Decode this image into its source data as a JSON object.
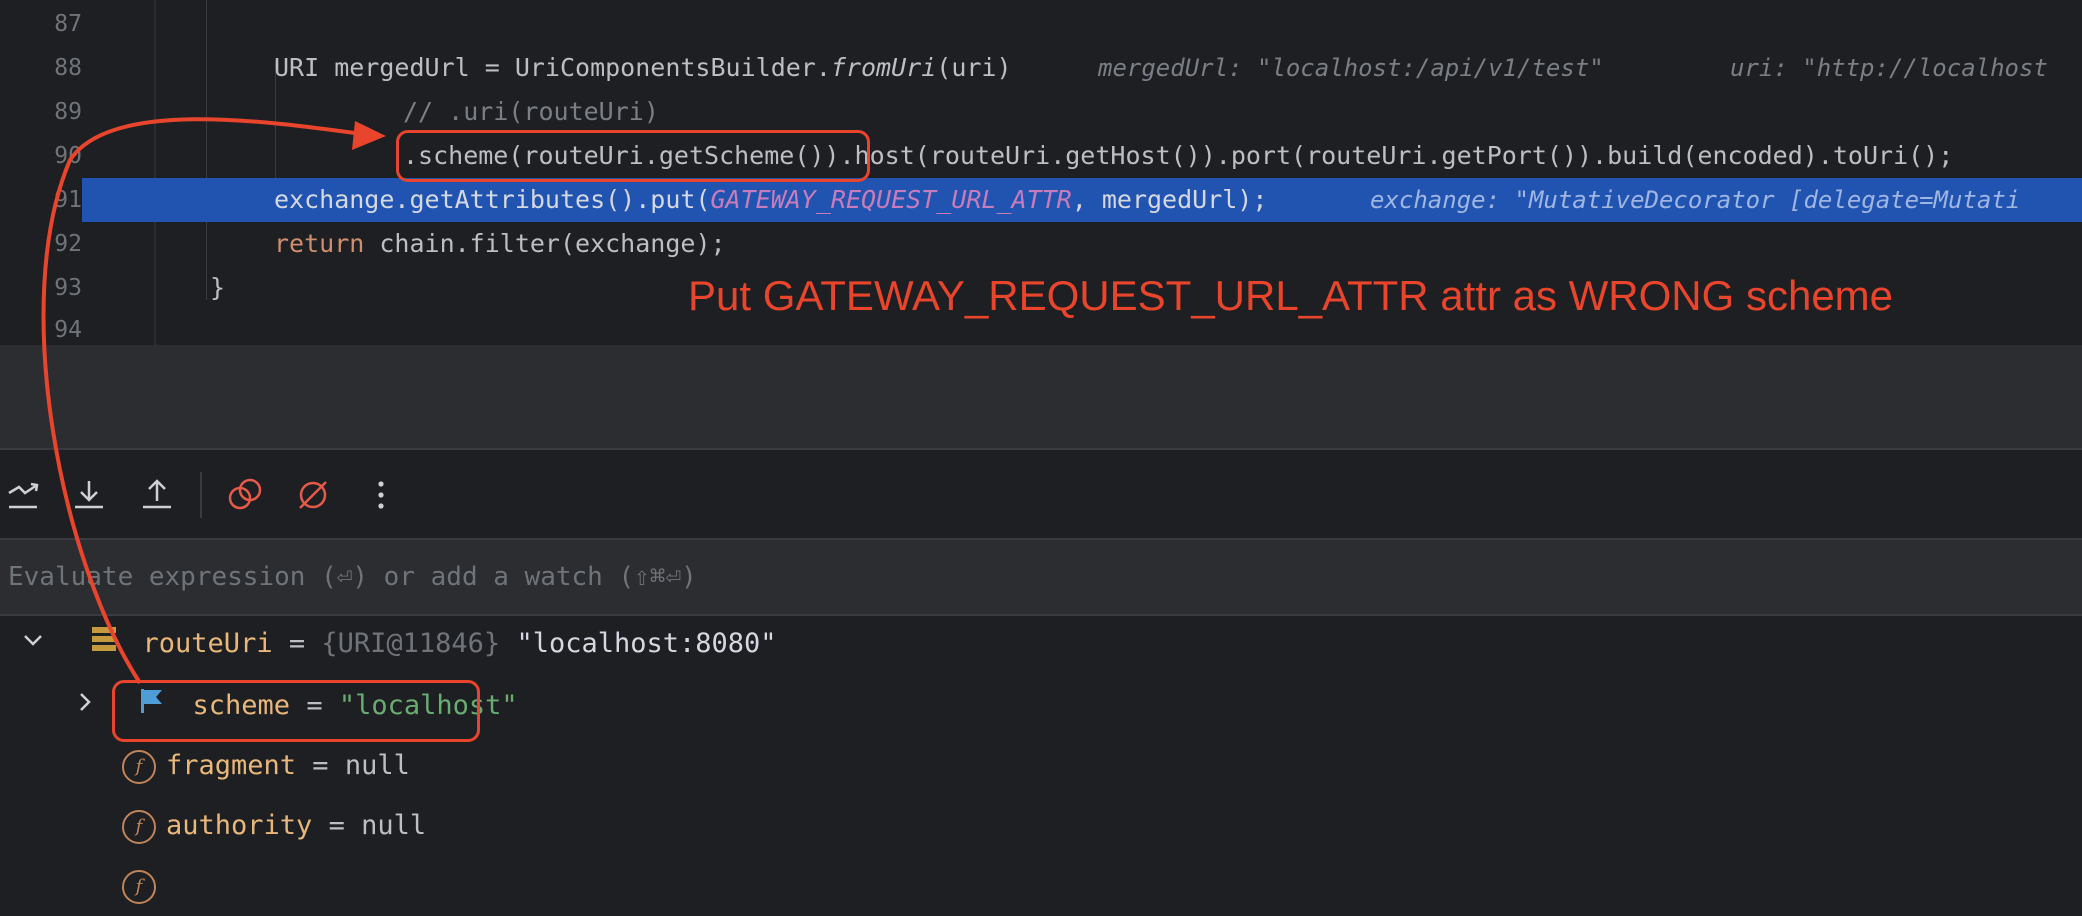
{
  "editor": {
    "lines": [
      {
        "num": "87"
      },
      {
        "num": "88",
        "prefix": "URI mergedUrl = UriComponentsBuilder.",
        "fn": "fromUri",
        "suffix": "(uri)",
        "hint1": "mergedUrl: \"localhost:/api/v1/test\"",
        "hint2": "uri: \"http://localhost"
      },
      {
        "num": "89",
        "comment": "// .uri(routeUri)"
      },
      {
        "num": "90",
        "code": ".scheme(routeUri.getScheme()).host(routeUri.getHost()).port(routeUri.getPort()).build(encoded).toUri();"
      },
      {
        "num": "91",
        "prefix": "exchange.getAttributes().put(",
        "constant": "GATEWAY_REQUEST_URL_ATTR",
        "suffix": ", mergedUrl);",
        "hint": "exchange: \"MutativeDecorator [delegate=Mutati"
      },
      {
        "num": "92",
        "keyword": "return",
        "code": " chain.filter(exchange);"
      },
      {
        "num": "93",
        "code": "}"
      },
      {
        "num": "94"
      }
    ]
  },
  "annotation": {
    "text": "Put GATEWAY_REQUEST_URL_ATTR attr as WRONG scheme",
    "color": "#e8452c"
  },
  "toolbar": {
    "buttons": [
      {
        "icon": "step-over-icon"
      },
      {
        "icon": "step-into-icon"
      },
      {
        "icon": "step-out-icon"
      },
      {
        "icon": "view-breakpoints-icon"
      },
      {
        "icon": "mute-breakpoints-icon"
      },
      {
        "icon": "more-options-icon"
      }
    ]
  },
  "evaluate": {
    "placeholder": "Evaluate expression (⏎) or add a watch (⇧⌘⏎)"
  },
  "variables": {
    "root": {
      "name": "routeUri",
      "eq": " = ",
      "type": "{URI@11846}",
      "value": "\"localhost:8080\""
    },
    "children": [
      {
        "name": "scheme",
        "eq": " = ",
        "value": "\"localhost\""
      },
      {
        "name": "fragment",
        "eq": " = ",
        "value": "null"
      },
      {
        "name": "authority",
        "eq": " = ",
        "value": "null"
      }
    ]
  }
}
